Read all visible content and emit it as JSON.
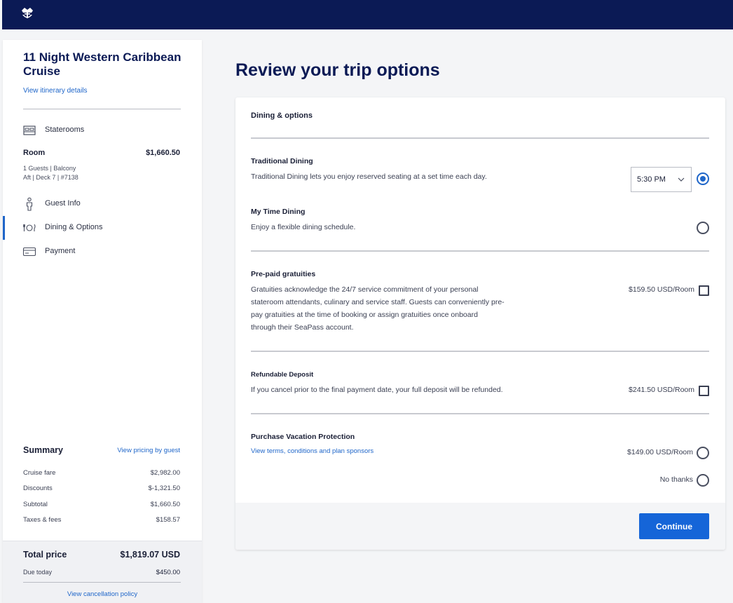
{
  "header": {
    "logo_icon": "crown-anchor-logo-icon",
    "bg_color": "#0b1a55"
  },
  "sidebar": {
    "trip_title": "11 Night Western Caribbean Cruise",
    "itinerary_link": "View itinerary details",
    "staterooms_label": "Staterooms",
    "room": {
      "label": "Room",
      "price": "$1,660.50",
      "line1": "1 Guests  |  Balcony",
      "line2": "Aft  |  Deck 7  |  #7138"
    },
    "nav": [
      {
        "label": "Guest Info",
        "icon": "person-icon",
        "active": false
      },
      {
        "label": "Dining & Options",
        "icon": "dining-icon",
        "active": true
      },
      {
        "label": "Payment",
        "icon": "credit-card-icon",
        "active": false
      }
    ],
    "summary": {
      "title": "Summary",
      "pricing_link": "View pricing by guest",
      "rows": [
        {
          "label": "Cruise fare",
          "value": "$2,982.00"
        },
        {
          "label": "Discounts",
          "value": "$-1,321.50"
        },
        {
          "label": "Subtotal",
          "value": "$1,660.50"
        },
        {
          "label": "Taxes & fees",
          "value": "$158.57"
        }
      ]
    },
    "total": {
      "label": "Total price",
      "value": "$1,819.07 USD",
      "due_label": "Due today",
      "due_value": "$450.00",
      "cancel_link": "View cancellation policy"
    }
  },
  "main": {
    "page_title": "Review your trip options",
    "section_title": "Dining & options",
    "traditional": {
      "title": "Traditional Dining",
      "desc": "Traditional Dining lets you enjoy reserved seating at a set time each day.",
      "time_value": "5:30 PM",
      "selected": true
    },
    "mytime": {
      "title": "My Time Dining",
      "desc": "Enjoy a flexible dining schedule.",
      "selected": false
    },
    "gratuities": {
      "title": "Pre-paid gratuities",
      "desc_lines": [
        "Gratuities acknowledge the 24/7 service commitment of your personal",
        "stateroom attendants, culinary and service staff. Guests can conveniently pre-",
        "pay gratuities at the time of booking or assign gratuities once onboard",
        "through their SeaPass account."
      ],
      "price": "$159.50 USD/Room",
      "checked": false
    },
    "deposit": {
      "title": "Refundable Deposit",
      "desc": "If you cancel prior to the final payment date, your full deposit will be refunded.",
      "price": "$241.50 USD/Room",
      "checked": false
    },
    "protection": {
      "title": "Purchase Vacation Protection",
      "terms_link": "View terms, conditions and plan sponsors",
      "price": "$149.00 USD/Room",
      "no_thanks": "No thanks"
    },
    "continue_label": "Continue"
  },
  "colors": {
    "accent": "#1f66c9",
    "button": "#1565d8",
    "navy": "#0b1a55"
  }
}
